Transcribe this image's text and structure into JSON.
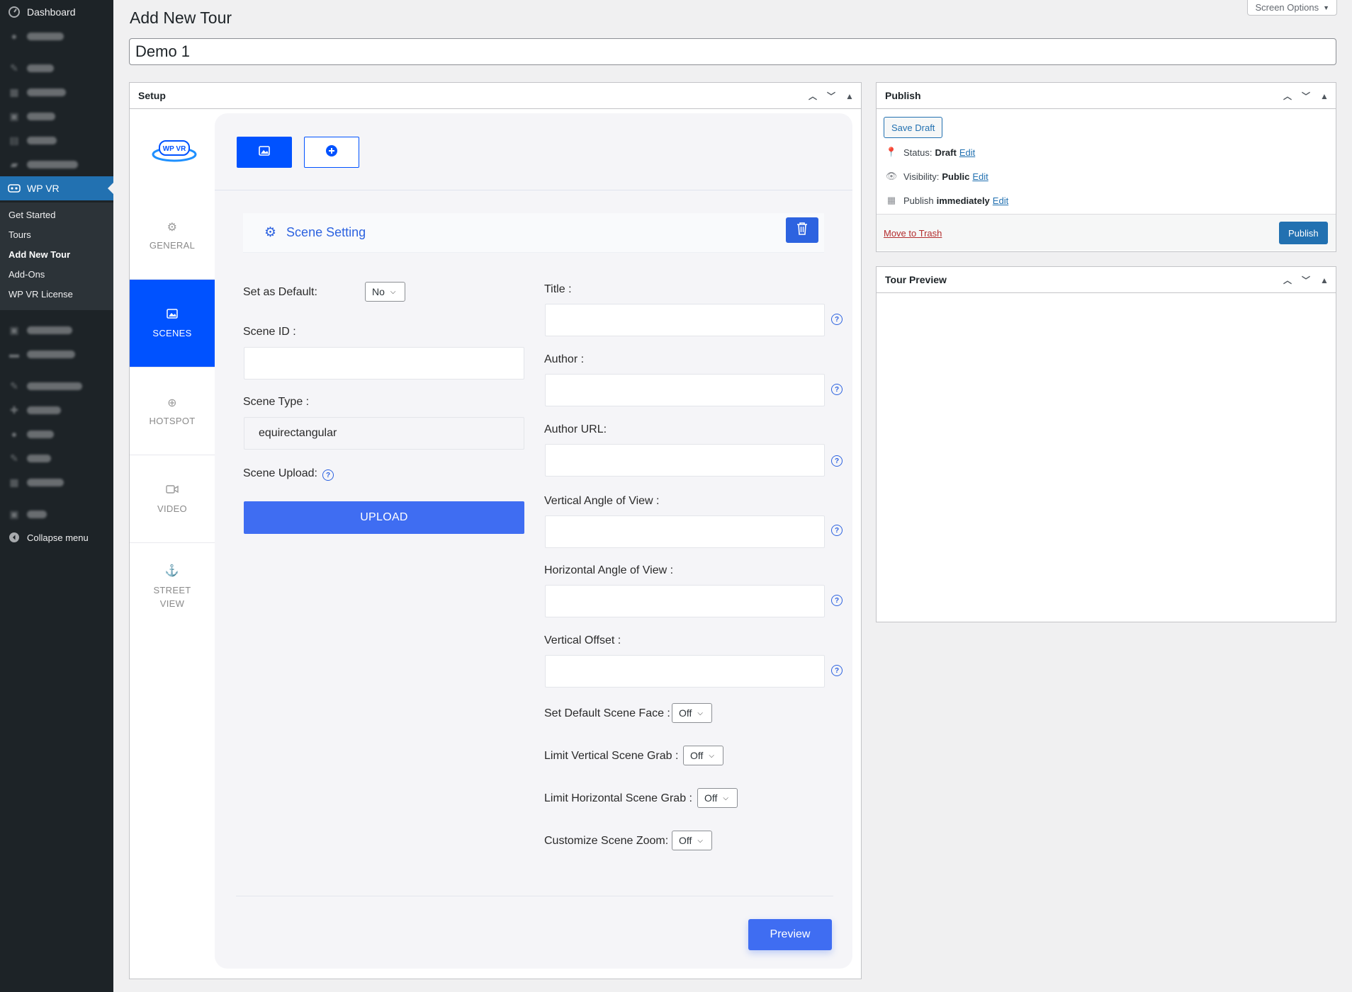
{
  "sidebar": {
    "dashboard": "Dashboard",
    "collapse": "Collapse menu",
    "wpvr": "WP VR",
    "submenu": [
      "Get Started",
      "Tours",
      "Add New Tour",
      "Add-Ons",
      "WP VR License"
    ]
  },
  "header": {
    "page_title": "Add New Tour",
    "screen_options": "Screen Options",
    "tour_title_value": "Demo 1"
  },
  "setup": {
    "title": "Setup",
    "logo_text": "WP VR",
    "tabs": [
      "GENERAL",
      "SCENES",
      "HOTSPOT",
      "VIDEO",
      "STREET VIEW"
    ],
    "scene_setting": "Scene Setting",
    "left": {
      "set_default_label": "Set as Default:",
      "set_default_value": "No",
      "scene_id_label": "Scene ID :",
      "scene_type_label": "Scene Type :",
      "scene_type_value": "equirectangular",
      "scene_upload_label": "Scene Upload:",
      "upload_button": "UPLOAD"
    },
    "right": {
      "title_label": "Title :",
      "author_label": "Author :",
      "author_url_label": "Author URL:",
      "vertical_angle_label": "Vertical Angle of View :",
      "horizontal_angle_label": "Horizontal Angle of View :",
      "vertical_offset_label": "Vertical Offset :",
      "default_face_label": "Set Default Scene Face :",
      "limit_vertical_label": "Limit Vertical Scene Grab :",
      "limit_horizontal_label": "Limit Horizontal Scene Grab :",
      "customize_zoom_label": "Customize Scene Zoom:",
      "off": "Off"
    },
    "preview_button": "Preview"
  },
  "publish": {
    "title": "Publish",
    "save_draft": "Save Draft",
    "status_label": "Status:",
    "status_value": "Draft",
    "visibility_label": "Visibility:",
    "visibility_value": "Public",
    "publish_label": "Publish",
    "publish_value": "immediately",
    "edit": "Edit",
    "move_to_trash": "Move to Trash",
    "publish_button": "Publish"
  },
  "tour_preview": {
    "title": "Tour Preview"
  },
  "colors": {
    "wp_admin_bg": "#1d2327",
    "wp_blue": "#2271b1",
    "wpvr_blue": "#0052ff",
    "accent_blue": "#3f6df2"
  }
}
